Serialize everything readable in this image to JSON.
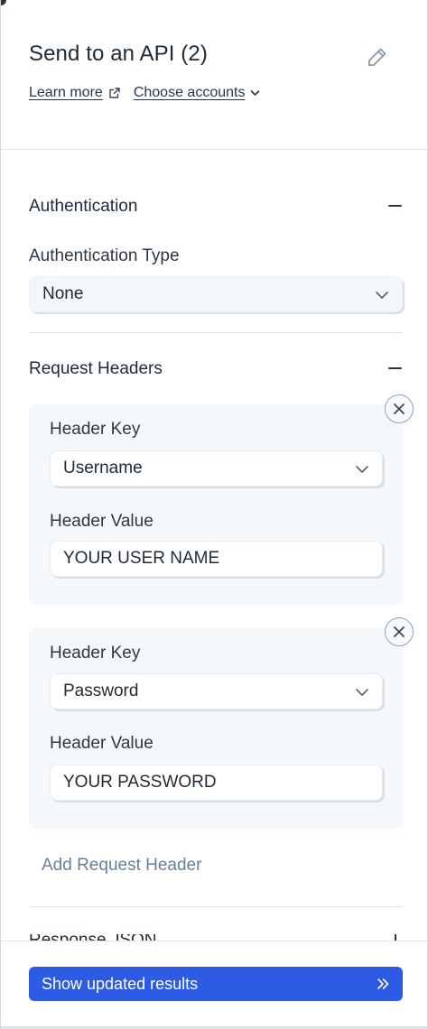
{
  "header": {
    "title": "Send to an API (2)",
    "learn_more": "Learn more",
    "choose_accounts": "Choose accounts"
  },
  "authentication": {
    "section_title": "Authentication",
    "type_label": "Authentication Type",
    "type_value": "None"
  },
  "request_headers": {
    "section_title": "Request Headers",
    "headers": [
      {
        "key_label": "Header Key",
        "key_value": "Username",
        "value_label": "Header Value",
        "value_value": "YOUR USER NAME"
      },
      {
        "key_label": "Header Key",
        "key_value": "Password",
        "value_label": "Header Value",
        "value_value": "YOUR PASSWORD"
      }
    ],
    "add_label": "Add Request Header"
  },
  "next_section": {
    "title": "Response JSON"
  },
  "footer": {
    "cta_label": "Show updated results"
  },
  "colors": {
    "accent": "#2d5be3",
    "muted_link": "#6a7f95",
    "card_bg": "#f5f8fb"
  },
  "icons": {
    "edit": "pencil-icon",
    "external": "external-link-icon",
    "chevron": "chevron-down-icon",
    "remove": "close-icon",
    "collapse": "minus-icon",
    "expand": "plus-icon",
    "cta": "double-chevron-right-icon"
  }
}
